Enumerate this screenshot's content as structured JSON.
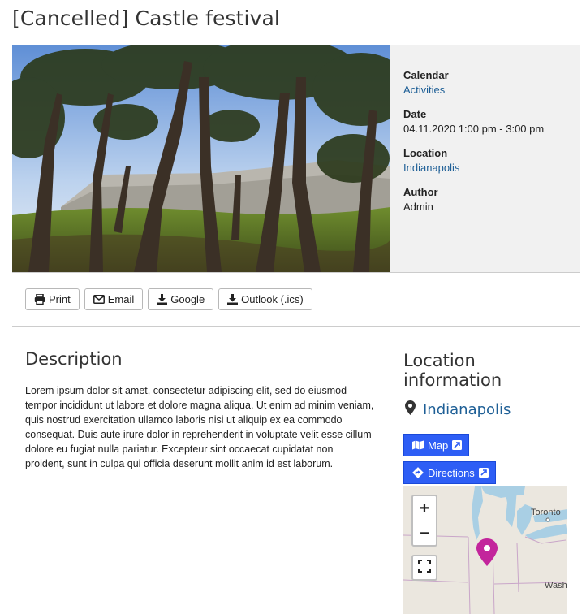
{
  "event": {
    "title": "[Cancelled] Castle festival"
  },
  "meta": {
    "calendar_label": "Calendar",
    "calendar_value": "Activities",
    "date_label": "Date",
    "date_value": "04.11.2020 1:00 pm - 3:00 pm",
    "location_label": "Location",
    "location_value": "Indianapolis",
    "author_label": "Author",
    "author_value": "Admin"
  },
  "toolbar": {
    "print_label": "Print",
    "email_label": "Email",
    "google_label": "Google",
    "outlook_label": "Outlook (.ics)"
  },
  "description": {
    "heading": "Description",
    "text": " Lorem ipsum dolor sit amet, consectetur adipiscing elit, sed do eiusmod tempor incididunt ut labore et dolore magna aliqua. Ut enim ad minim veniam, quis nostrud exercitation ullamco laboris nisi ut aliquip ex ea commodo consequat. Duis aute irure dolor in reprehenderit in voluptate velit esse cillum dolore eu fugiat nulla pariatur. Excepteur sint occaecat cupidatat non proident, sunt in culpa qui officia deserunt mollit anim id est laborum."
  },
  "location_info": {
    "heading": "Location information",
    "place": "Indianapolis",
    "map_button": "Map",
    "directions_button": "Directions"
  },
  "map": {
    "zoom_in": "+",
    "zoom_out": "−",
    "label_toronto": "Toronto",
    "label_wash": "Wash"
  },
  "colors": {
    "link": "#1e5f96",
    "primary_button": "#2e5ef5",
    "map_pin": "#c3259c",
    "meta_background": "#f1f1f1"
  },
  "icons": {
    "print": "printer-icon",
    "email": "envelope-icon",
    "google": "download-icon",
    "outlook": "download-icon",
    "location": "map-marker-icon",
    "map": "map-icon",
    "directions": "directions-icon",
    "external": "external-link-icon"
  }
}
